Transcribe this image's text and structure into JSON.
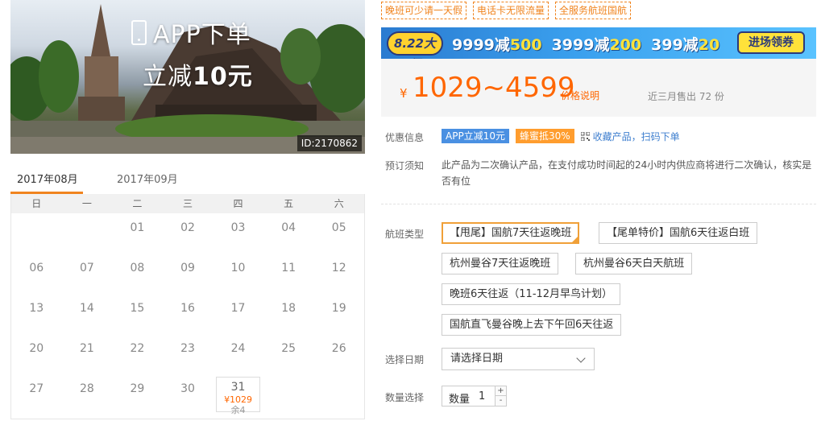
{
  "hero": {
    "overlay_line1": "APP下单",
    "overlay_line2_prefix": "立减",
    "overlay_line2_amount": "10元",
    "image_id": "ID:2170862"
  },
  "calendar": {
    "months": [
      "2017年08月",
      "2017年09月"
    ],
    "active_month_index": 0,
    "weekdays": [
      "日",
      "一",
      "二",
      "三",
      "四",
      "五",
      "六"
    ],
    "days": [
      {
        "day": ""
      },
      {
        "day": ""
      },
      {
        "day": "01"
      },
      {
        "day": "02"
      },
      {
        "day": "03"
      },
      {
        "day": "04"
      },
      {
        "day": "05"
      },
      {
        "day": "06"
      },
      {
        "day": "07"
      },
      {
        "day": "08"
      },
      {
        "day": "09"
      },
      {
        "day": "10"
      },
      {
        "day": "11"
      },
      {
        "day": "12"
      },
      {
        "day": "13"
      },
      {
        "day": "14"
      },
      {
        "day": "15"
      },
      {
        "day": "16"
      },
      {
        "day": "17"
      },
      {
        "day": "18"
      },
      {
        "day": "19"
      },
      {
        "day": "20"
      },
      {
        "day": "21"
      },
      {
        "day": "22"
      },
      {
        "day": "23"
      },
      {
        "day": "24"
      },
      {
        "day": "25"
      },
      {
        "day": "26"
      },
      {
        "day": "27"
      },
      {
        "day": "28"
      },
      {
        "day": "29"
      },
      {
        "day": "30"
      },
      {
        "day": "31",
        "price": "¥1029",
        "stock": "余4"
      }
    ]
  },
  "promo_tags": [
    "晚班可少请一天假",
    "电话卡无限流量",
    "全服务航班国航"
  ],
  "banner": {
    "badge": "8.22大促",
    "offers": [
      {
        "prefix": "9999减",
        "amount": "500"
      },
      {
        "prefix": "3999减",
        "amount": "200"
      },
      {
        "prefix": "399减",
        "amount": "20"
      }
    ],
    "cta": "进场领券"
  },
  "price": {
    "symbol": "¥",
    "range": "1029~4599",
    "note_link": "价格说明",
    "sales": "近三月售出 72 份"
  },
  "discount": {
    "label": "优惠信息",
    "app_badge": "APP立减10元",
    "honey_badge": "蜂蜜抵30%",
    "qr_link": "收藏产品，扫码下单"
  },
  "booking": {
    "label": "预订须知",
    "note": "此产品为二次确认产品，在支付成功时间起的24小时内供应商将进行二次确认，核实是否有位"
  },
  "flight_type": {
    "label": "航班类型",
    "options": [
      "【甩尾】国航7天往返晚班",
      "【尾单特价】国航6天往返白班",
      "杭州曼谷7天往返晚班",
      "杭州曼谷6天白天航班",
      "晚班6天往返（11-12月早鸟计划）",
      "国航直飞曼谷晚上去下午回6天往返"
    ],
    "selected_index": 0
  },
  "date_select": {
    "label": "选择日期",
    "placeholder": "请选择日期"
  },
  "quantity": {
    "label": "数量选择",
    "field_label": "数量",
    "value": "1",
    "plus": "+",
    "minus": "-"
  }
}
